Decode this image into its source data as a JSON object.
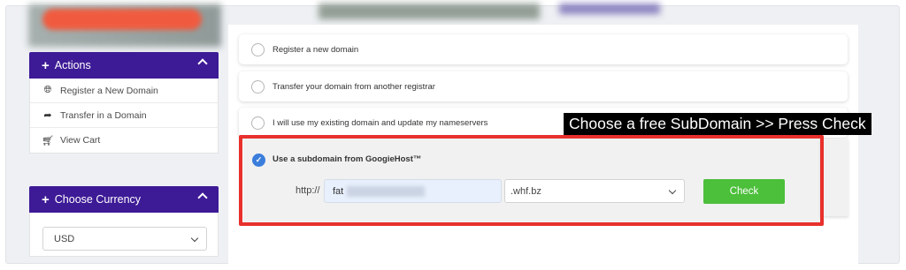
{
  "sidebar": {
    "actions_panel": {
      "title": "Actions",
      "items": [
        {
          "label": "Register a New Domain",
          "icon": "globe-icon"
        },
        {
          "label": "Transfer in a Domain",
          "icon": "share-arrow-icon"
        },
        {
          "label": "View Cart",
          "icon": "cart-icon"
        }
      ]
    },
    "currency_panel": {
      "title": "Choose Currency",
      "selected": "USD"
    }
  },
  "domain_options": [
    {
      "label": "Register a new domain",
      "checked": false
    },
    {
      "label": "Transfer your domain from another registrar",
      "checked": false
    },
    {
      "label": "I will use my existing domain and update my nameservers",
      "checked": false
    },
    {
      "label": "Use a subdomain from GoogieHost™",
      "checked": true
    }
  ],
  "subdomain_form": {
    "prefix": "http://",
    "input_value": "fat",
    "tld_selected": ".whf.bz",
    "check_label": "Check"
  },
  "annotation": {
    "caption": "Choose a free SubDomain >> Press Check"
  },
  "colors": {
    "panel_header": "#3d1a96",
    "check_button": "#4cbf3b",
    "highlight_box": "#e8302c",
    "radio_checked": "#3b7ddb"
  }
}
